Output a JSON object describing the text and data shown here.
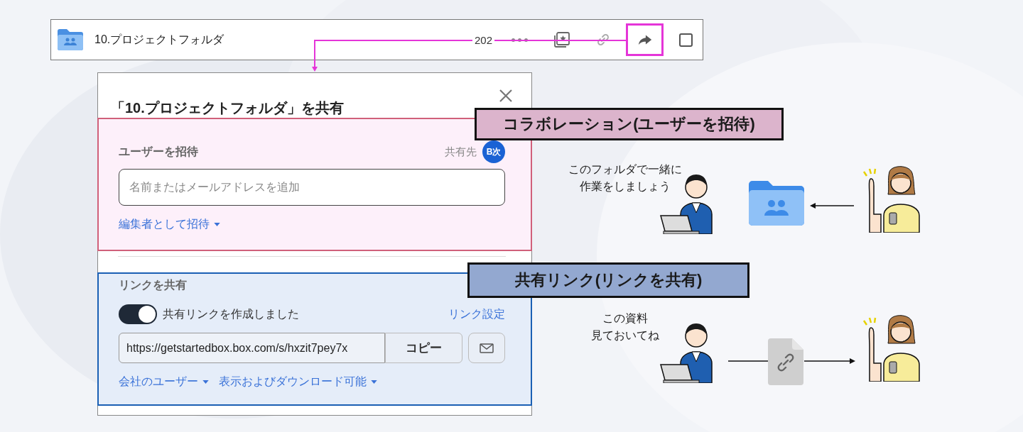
{
  "file_row": {
    "name": "10.プロジェクトフォルダ",
    "date": "202",
    "checked": false
  },
  "dialog": {
    "title": "「10.プロジェクトフォルダ」を共有",
    "invite": {
      "heading": "ユーザーを招待",
      "shared_with_label": "共有先",
      "avatar": "B次",
      "placeholder": "名前またはメールアドレスを追加",
      "role_link": "編集者として招待"
    },
    "link": {
      "heading": "リンクを共有",
      "toggle": {
        "label": "共有リンクを作成しました",
        "on": true
      },
      "settings_link": "リンク設定",
      "url": "https://getstartedbox.box.com/s/hxzit7pey7x",
      "copy_button": "コピー",
      "access_link": "会社のユーザー",
      "permission_link": "表示およびダウンロード可能"
    }
  },
  "callouts": [
    {
      "text": "コラボレーション(ユーザーを招待)",
      "color": "#dcb4cc"
    },
    {
      "text": "共有リンク(リンクを共有)",
      "color": "#93a8d0"
    }
  ],
  "scenes": [
    {
      "kind": "folder",
      "speech": [
        "このフォルダで一緒に",
        "作業をしましょう"
      ]
    },
    {
      "kind": "link",
      "speech": [
        "この資料",
        "見ておいてね"
      ]
    }
  ]
}
